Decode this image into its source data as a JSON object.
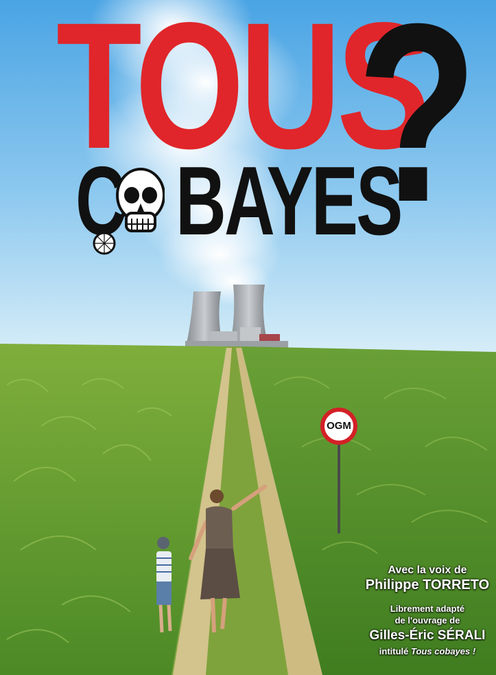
{
  "poster": {
    "title_word1": "TOUS",
    "question_mark": "?",
    "title_word2_first": "C",
    "title_word2_rest": "BAYES",
    "skull_icon": "skull-icon",
    "sign_text": "OGM"
  },
  "credits": {
    "voice_line": "Avec la voix de",
    "actor": "Philippe TORRETO",
    "adapted_line1": "Librement adapté",
    "adapted_line2": "de l'ouvrage de",
    "author": "Gilles-Éric SÉRALI",
    "intitule_prefix": "intitulé",
    "intitule_title": "Tous cobayes !"
  },
  "colors": {
    "title_red": "#e0262a",
    "title_black": "#111111",
    "sky": "#6fb3e6",
    "field_green": "#5f9a2a",
    "path_tan": "#cdbd86"
  }
}
